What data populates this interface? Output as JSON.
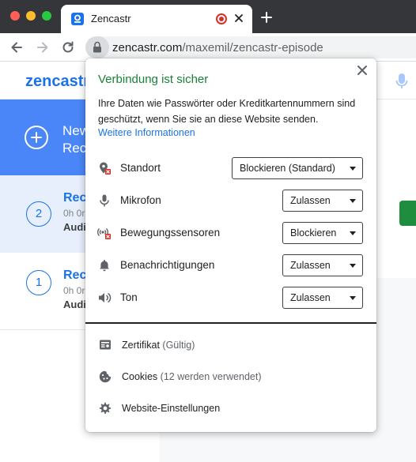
{
  "browser": {
    "tab_title": "Zencastr",
    "url_domain": "zencastr.com",
    "url_path": "/maxemil/zencastr-episode"
  },
  "app": {
    "logo_text": "zencastr",
    "new_recording": {
      "line1": "New",
      "line2": "Rec"
    },
    "recordings": [
      {
        "number": "2",
        "name": "Reco",
        "meta": "0h 0r",
        "audio": "Audio"
      },
      {
        "number": "1",
        "name": "Reco",
        "meta": "0h 0r",
        "audio": "Audio"
      }
    ]
  },
  "popup": {
    "title": "Verbindung ist sicher",
    "description": "Ihre Daten wie Passwörter oder Kreditkartennummern sind geschützt, wenn Sie sie an diese Website senden.",
    "more_info_link": "Weitere Informationen",
    "permissions": [
      {
        "label": "Standort",
        "value": "Blockieren (Standard)",
        "icon": "location-blocked-icon"
      },
      {
        "label": "Mikrofon",
        "value": "Zulassen",
        "icon": "microphone-icon"
      },
      {
        "label": "Bewegungssensoren",
        "value": "Blockieren",
        "icon": "motion-sensors-blocked-icon"
      },
      {
        "label": "Benachrichtigungen",
        "value": "Zulassen",
        "icon": "bell-icon"
      },
      {
        "label": "Ton",
        "value": "Zulassen",
        "icon": "speaker-icon"
      }
    ],
    "certificate": {
      "label": "Zertifikat",
      "status": "(Gültig)"
    },
    "cookies": {
      "label": "Cookies",
      "status": "(12 werden verwendet)"
    },
    "site_settings": "Website-Einstellungen"
  },
  "colors": {
    "secure_green": "#188038",
    "link_blue": "#1a73e8",
    "blocked_red": "#d93025",
    "brand_blue": "#4a86f7"
  }
}
